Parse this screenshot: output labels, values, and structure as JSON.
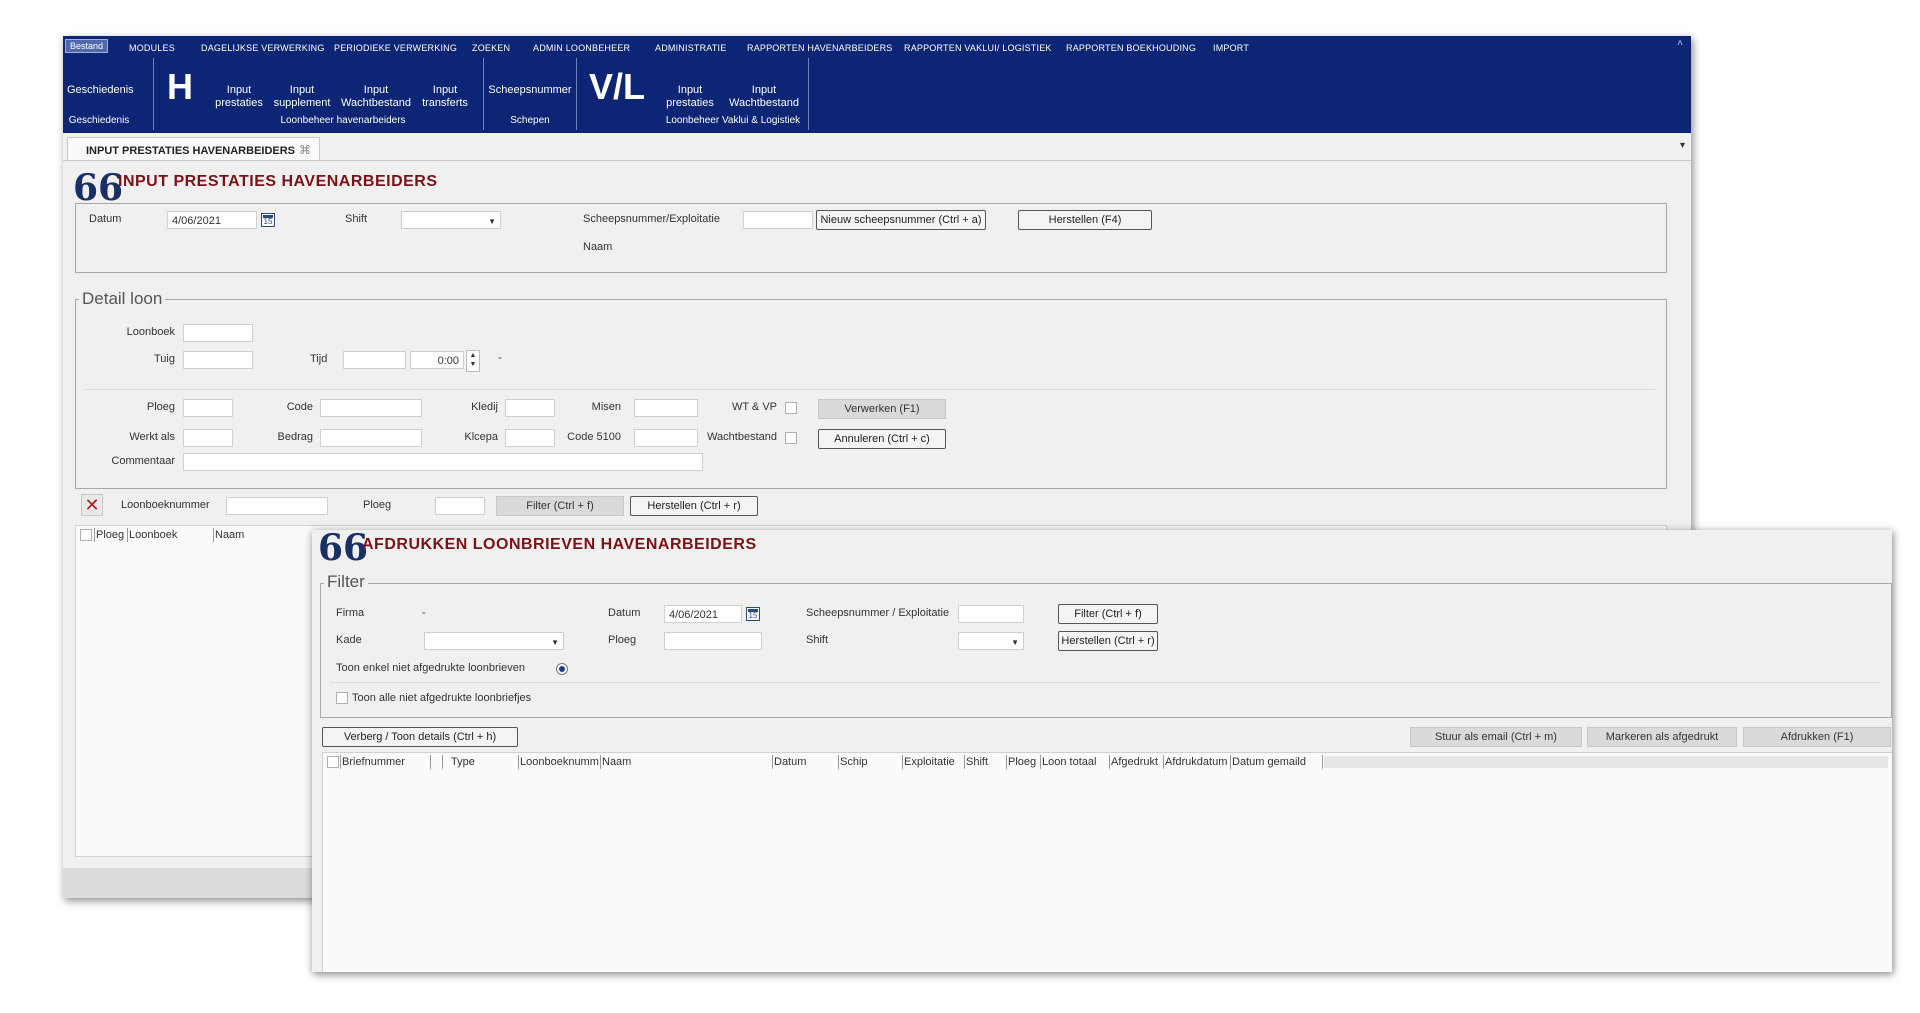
{
  "main_window": {
    "menu": {
      "bestand": "Bestand",
      "items": [
        "MODULES",
        "DAGELIJKSE VERWERKING",
        "PERIODIEKE VERWERKING",
        "ZOEKEN",
        "ADMIN LOONBEHEER",
        "ADMINISTRATIE",
        "RAPPORTEN HAVENARBEIDERS",
        "RAPPORTEN VAKLUI/ LOGISTIEK",
        "RAPPORTEN BOEKHOUDING",
        "IMPORT"
      ],
      "collapse_glyph": "˄"
    },
    "ribbon": {
      "geschiedenis_btn": "Geschiedenis",
      "geschiedenis_group": "Geschiedenis",
      "h_letter": "H",
      "h_buttons": [
        {
          "line1": "Input",
          "line2": "prestaties"
        },
        {
          "line1": "Input",
          "line2": "supplement"
        },
        {
          "line1": "Input",
          "line2": "Wachtbestand"
        },
        {
          "line1": "Input",
          "line2": "transferts"
        }
      ],
      "h_group": "Loonbeheer havenarbeiders",
      "schepen_btn": "Scheepsnummer",
      "schepen_group": "Schepen",
      "vl_letter": "V/L",
      "vl_buttons": [
        {
          "line1": "Input",
          "line2": "prestaties"
        },
        {
          "line1": "Input",
          "line2": "Wachtbestand"
        }
      ],
      "vl_group": "Loonbeheer Vaklui & Logistiek"
    },
    "tab": {
      "label": "INPUT PRESTATIES HAVENARBEIDERS",
      "close_glyph": "⌘",
      "menu_glyph": "▾"
    },
    "page_title": "INPUT PRESTATIES HAVENARBEIDERS",
    "quote_glyph": "66",
    "header_form": {
      "datum_label": "Datum",
      "datum_value": "4/06/2021",
      "shift_label": "Shift",
      "scheepsnummer_label": "Scheepsnummer/Exploitatie",
      "naam_label": "Naam",
      "nieuw_button": "Nieuw scheepsnummer (Ctrl + a)",
      "herstellen_button": "Herstellen (F4)"
    },
    "detail_loon": {
      "legend": "Detail loon",
      "loonboek_label": "Loonboek",
      "tuig_label": "Tuig",
      "tijd_label": "Tijd",
      "tijd_value": "0:00",
      "dash": "-",
      "ploeg_label": "Ploeg",
      "code_label": "Code",
      "kledij_label": "Kledij",
      "misen_label": "Misen",
      "wtvp_label": "WT & VP",
      "verwerken_button": "Verwerken (F1)",
      "werkt_als_label": "Werkt als",
      "bedrag_label": "Bedrag",
      "klcepa_label": "Klcepa",
      "code5100_label": "Code 5100",
      "wachtbestand_label": "Wachtbestand",
      "annuleren_button": "Annuleren (Ctrl + c)",
      "commentaar_label": "Commentaar"
    },
    "filter_bar": {
      "loonboeknummer_label": "Loonboeknummer",
      "ploeg_label": "Ploeg",
      "filter_button": "Filter (Ctrl + f)",
      "herstellen_button": "Herstellen (Ctrl + r)"
    },
    "grid_columns": [
      "Ploeg",
      "Loonboek",
      "Naam"
    ]
  },
  "print_window": {
    "title": "AFDRUKKEN LOONBRIEVEN HAVENARBEIDERS",
    "quote_glyph": "66",
    "filter": {
      "legend": "Filter",
      "firma_label": "Firma",
      "firma_value": "-",
      "datum_label": "Datum",
      "datum_value": "4/06/2021",
      "scheepsnummer_label": "Scheepsnummer / Exploitatie",
      "filter_button": "Filter (Ctrl + f)",
      "kade_label": "Kade",
      "ploeg_label": "Ploeg",
      "shift_label": "Shift",
      "herstellen_button": "Herstellen (Ctrl + r)",
      "toon_enkel_label": "Toon enkel niet afgedrukte loonbrieven",
      "toon_alle_label": "Toon alle niet afgedrukte loonbriefjes"
    },
    "toolbar": {
      "verberg_button": "Verberg / Toon details (Ctrl + h)",
      "email_button": "Stuur als email (Ctrl + m)",
      "markeren_button": "Markeren als afgedrukt",
      "afdrukken_button": "Afdrukken (F1)"
    },
    "grid_columns": [
      "Briefnummer",
      "Type",
      "Loonboeknumm",
      "Naam",
      "Datum",
      "Schip",
      "Exploitatie",
      "Shift",
      "Ploeg",
      "Loon totaal",
      "Afgedrukt",
      "Afdrukdatum",
      "Datum gemaild"
    ]
  },
  "colors": {
    "navbar": "#0c2575",
    "heading": "#7b1216",
    "quote_icon": "#1b2f67",
    "clear_filter": "#b01d1d"
  }
}
